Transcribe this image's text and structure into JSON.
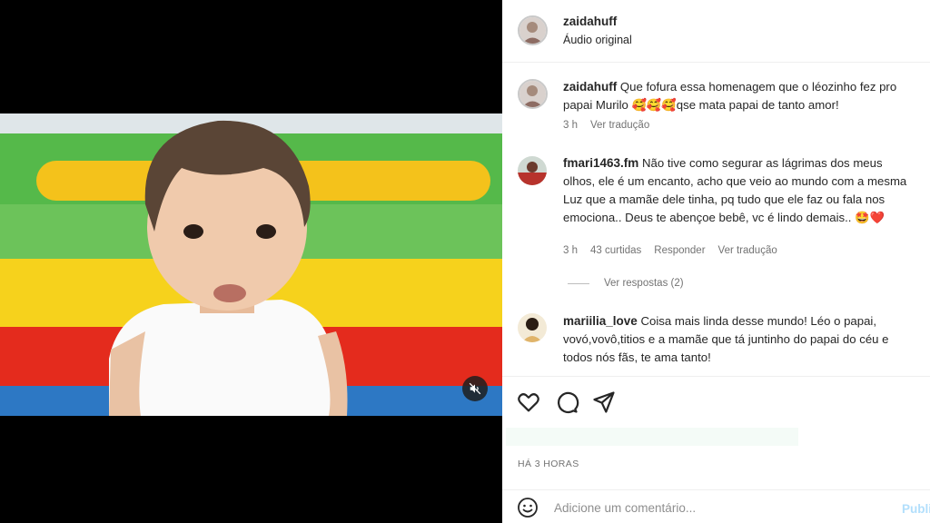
{
  "header": {
    "username": "zaidahuff",
    "subtitle": "Áudio original"
  },
  "comments": [
    {
      "username": "zaidahuff",
      "text": "Que fofura essa homenagem que o léozinho fez pro papai Murilo 🥰🥰🥰qse mata papai de tanto amor!",
      "time": "3 h",
      "translate": "Ver tradução"
    },
    {
      "username": "fmari1463.fm",
      "text": "Não tive como segurar as lágrimas dos meus olhos, ele é um encanto, acho que veio ao mundo com a mesma Luz que a mamãe dele tinha, pq tudo que ele faz ou fala nos emociona.. Deus te abençoe bebê, vc é lindo demais.. 🤩❤️",
      "time": "3 h",
      "likes": "43 curtidas",
      "reply": "Responder",
      "translate": "Ver tradução",
      "view_replies": "Ver respostas (2)"
    },
    {
      "username": "mariilia_love",
      "text": "Coisa mais linda desse mundo! Léo o papai, vovó,vovô,titios e a mamãe que tá juntinho do papai do céu e todos nós fãs, te ama tanto!"
    }
  ],
  "post_time": "HÁ 3 HORAS",
  "add_comment": {
    "placeholder": "Adicione um comentário...",
    "post_label": "Publicar"
  },
  "icons": [
    "heart-icon",
    "comment-icon",
    "share-icon",
    "mute-icon",
    "emoji-icon"
  ],
  "colors": {
    "link": "#b2dffc",
    "muted": "#737373"
  }
}
